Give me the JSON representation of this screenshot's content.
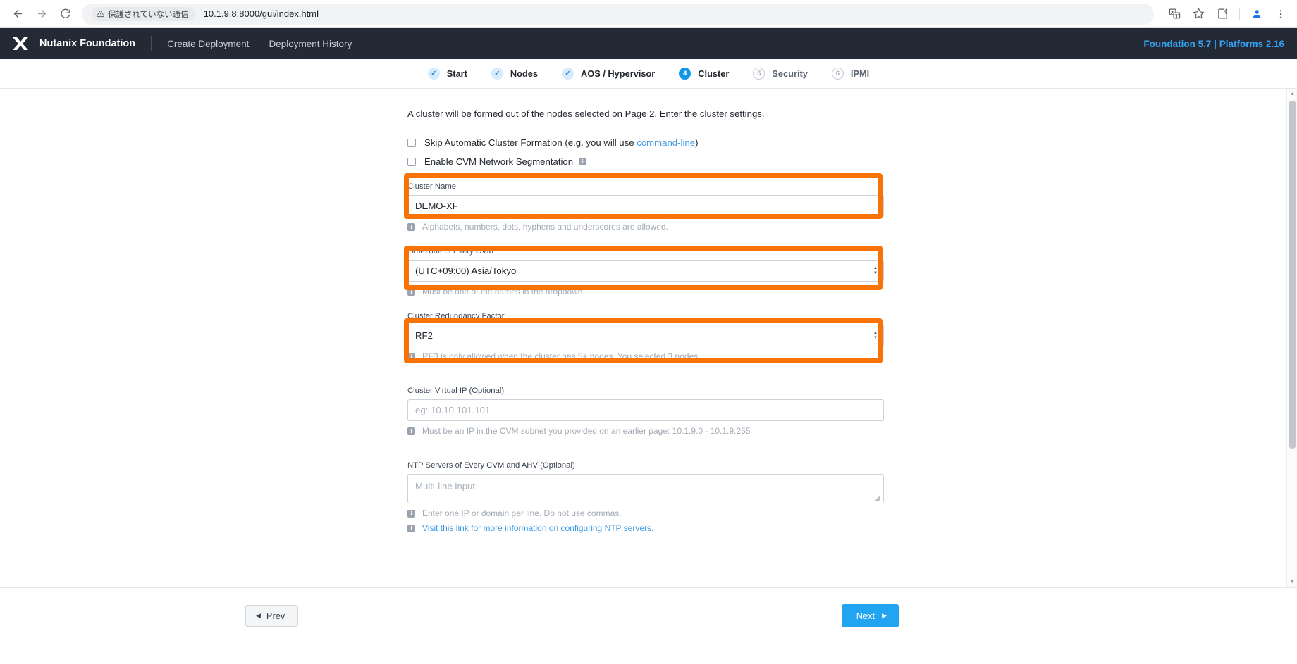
{
  "browser": {
    "back_icon": "back-arrow-icon",
    "forward_icon": "forward-arrow-icon",
    "reload_icon": "reload-icon",
    "security_label": "保護されていない通信",
    "url": "10.1.9.8:8000/gui/index.html",
    "translate_icon": "translate-icon",
    "bookmark_icon": "star-icon",
    "extensions_icon": "puzzle-piece-icon",
    "profile_icon": "profile-avatar-icon",
    "menu_icon": "three-dot-menu-icon"
  },
  "app_header": {
    "logo": "nutanix-x-logo",
    "title": "Nutanix Foundation",
    "nav": [
      {
        "label": "Create Deployment"
      },
      {
        "label": "Deployment History"
      }
    ],
    "version": "Foundation 5.7 | Platforms 2.16",
    "version_color": "#35a3f3"
  },
  "stepper": {
    "steps": [
      {
        "badge": "✓",
        "label": "Start",
        "state": "done"
      },
      {
        "badge": "✓",
        "label": "Nodes",
        "state": "done"
      },
      {
        "badge": "✓",
        "label": "AOS / Hypervisor",
        "state": "done"
      },
      {
        "badge": "4",
        "label": "Cluster",
        "state": "active"
      },
      {
        "badge": "5",
        "label": "Security",
        "state": "todo"
      },
      {
        "badge": "6",
        "label": "IPMI",
        "state": "todo"
      }
    ],
    "active_color": "#1296e6",
    "done_color": "#d6ebfb"
  },
  "form": {
    "intro": "A cluster will be formed out of the nodes selected on Page 2. Enter the cluster settings.",
    "checkbox_skip": {
      "text_before": "Skip Automatic Cluster Formation (e.g. you will use ",
      "link": "command-line",
      "text_after": ")",
      "checked": false
    },
    "checkbox_segmentation": {
      "label": "Enable CVM Network Segmentation",
      "info_icon": "info-icon",
      "checked": false
    },
    "cluster_name": {
      "label": "Cluster Name",
      "value": "DEMO-XF",
      "helper": "Alphabets, numbers, dots, hyphens and underscores are allowed."
    },
    "timezone": {
      "label": "Timezone of Every CVM",
      "value": "(UTC+09:00) Asia/Tokyo",
      "helper": "Must be one of the names in the dropdown."
    },
    "redundancy": {
      "label": "Cluster Redundancy Factor",
      "value": "RF2",
      "helper": "RF3 is only allowed when the cluster has 5+ nodes. You selected 3 nodes."
    },
    "virtual_ip": {
      "label": "Cluster Virtual IP (Optional)",
      "value": "",
      "placeholder": "eg: 10.10.101.101",
      "helper": "Must be an IP in the CVM subnet you provided on an earlier page: 10.1.9.0 - 10.1.9.255"
    },
    "ntp": {
      "label": "NTP Servers of Every CVM and AHV (Optional)",
      "value": "",
      "placeholder": "Multi-line input",
      "helper": "Enter one IP or domain per line. Do not use commas.",
      "link_helper": "Visit this link for more information on configuring NTP servers."
    },
    "highlight_color": "#f97304"
  },
  "footer": {
    "prev_label": "Prev",
    "next_label": "Next",
    "next_color": "#22a5f0"
  },
  "scrollbar": {
    "up_arrow": "scroll-up-arrow",
    "down_arrow": "scroll-down-arrow"
  }
}
